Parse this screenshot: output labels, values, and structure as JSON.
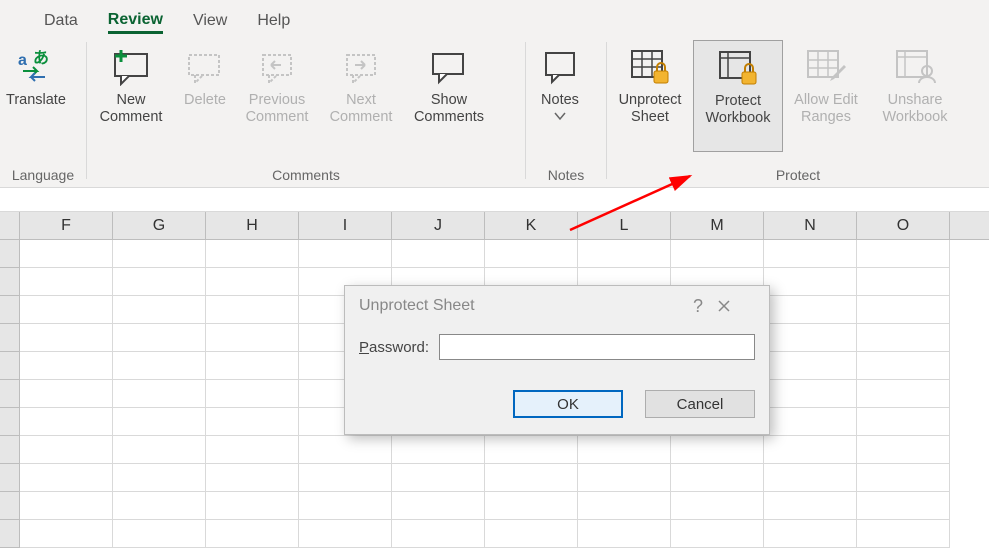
{
  "tabs": {
    "data": "Data",
    "review": "Review",
    "view": "View",
    "help": "Help"
  },
  "ribbon": {
    "language_group": "Language",
    "translate": "Translate",
    "comments_group": "Comments",
    "new_comment_l1": "New",
    "new_comment_l2": "Comment",
    "delete": "Delete",
    "previous_l1": "Previous",
    "previous_l2": "Comment",
    "next_l1": "Next",
    "next_l2": "Comment",
    "show_l1": "Show",
    "show_l2": "Comments",
    "notes_group": "Notes",
    "notes": "Notes",
    "protect_group": "Protect",
    "unprotect_l1": "Unprotect",
    "unprotect_l2": "Sheet",
    "protectwb_l1": "Protect",
    "protectwb_l2": "Workbook",
    "allowedit_l1": "Allow Edit",
    "allowedit_l2": "Ranges",
    "unshare_l1": "Unshare",
    "unshare_l2": "Workbook"
  },
  "cols": [
    "F",
    "G",
    "H",
    "I",
    "J",
    "K",
    "L",
    "M",
    "N",
    "O"
  ],
  "dialog": {
    "title": "Unprotect Sheet",
    "password_label_plain": "assword:",
    "ok": "OK",
    "cancel": "Cancel"
  }
}
